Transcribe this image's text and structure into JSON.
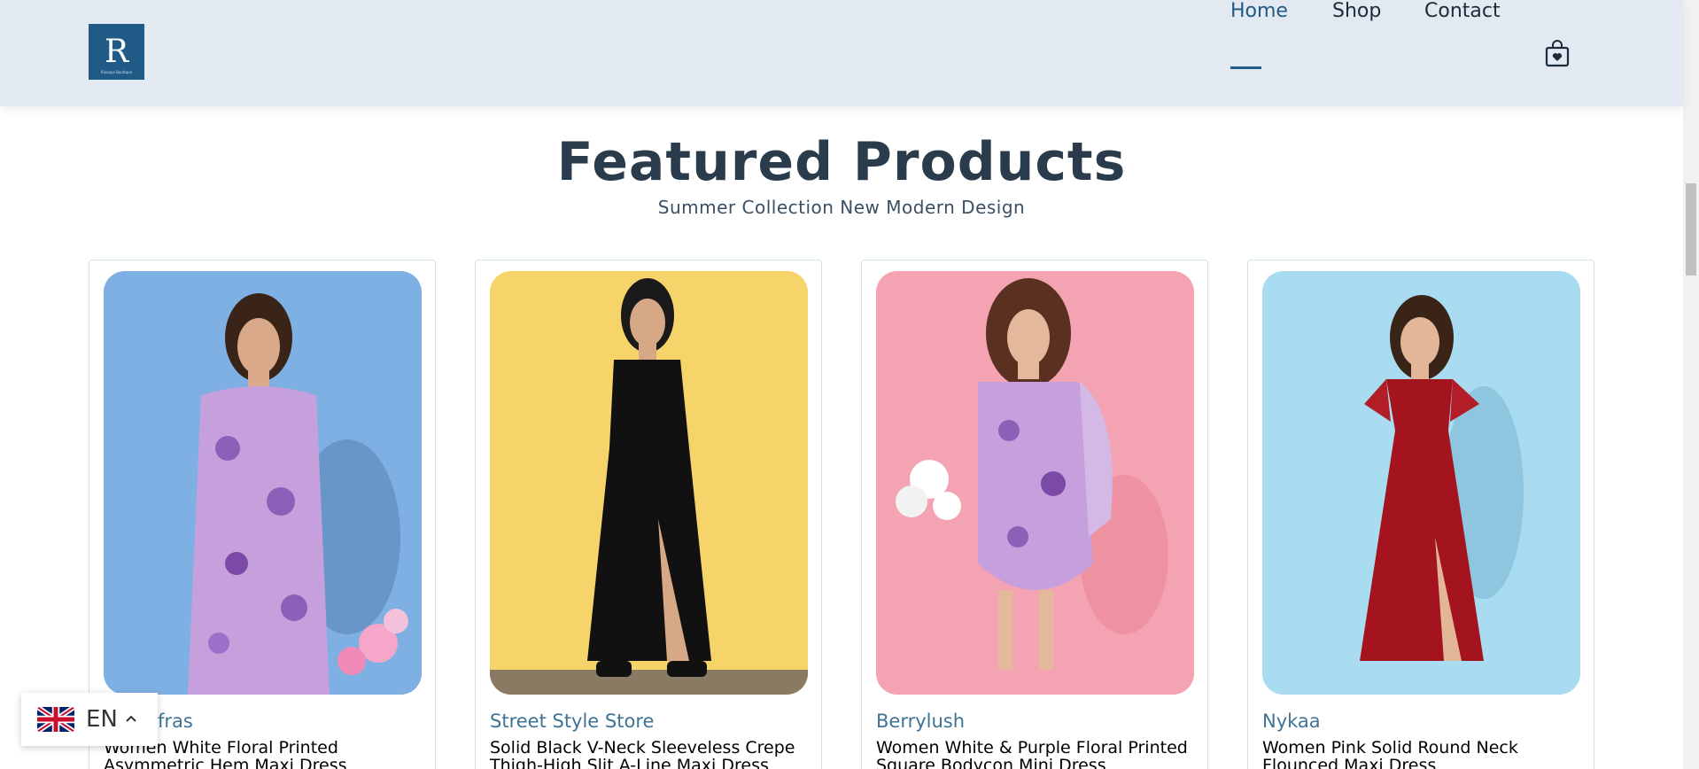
{
  "header": {
    "logo_letter": "R",
    "logo_text": "Rivaaya Boutique",
    "nav": [
      {
        "label": "Home",
        "active": true
      },
      {
        "label": "Shop",
        "active": false
      },
      {
        "label": "Contact",
        "active": false
      }
    ],
    "cart_icon": "shopping-bag-icon"
  },
  "section": {
    "title": "Featured Products",
    "subtitle": "Summer Collection New Modern Design"
  },
  "products": [
    {
      "brand": "Sassafras",
      "name": "Women White Floral Printed Asymmetric Hem Maxi Dress",
      "background": "#7fb0e3",
      "dress_color": "#b98ad6"
    },
    {
      "brand": "Street Style Store",
      "name": "Solid Black V-Neck Sleeveless Crepe Thigh-High Slit A-Line Maxi Dress",
      "background": "#f7d46a",
      "dress_color": "#111111"
    },
    {
      "brand": "Berrylush",
      "name": "Women White & Purple Floral Printed Square Bodycon Mini Dress",
      "background": "#f4a3b2",
      "dress_color": "#b78ad3"
    },
    {
      "brand": "Nykaa",
      "name": "Women Pink Solid Round Neck Flounced Maxi Dress",
      "background": "#a9dcf1",
      "dress_color": "#a3141e"
    }
  ],
  "language": {
    "code": "EN",
    "flag_icon": "uk-flag-icon"
  },
  "colors": {
    "header_bg": "#e3e9f1",
    "accent": "#1f5b86",
    "brand_text": "#3f7396"
  }
}
